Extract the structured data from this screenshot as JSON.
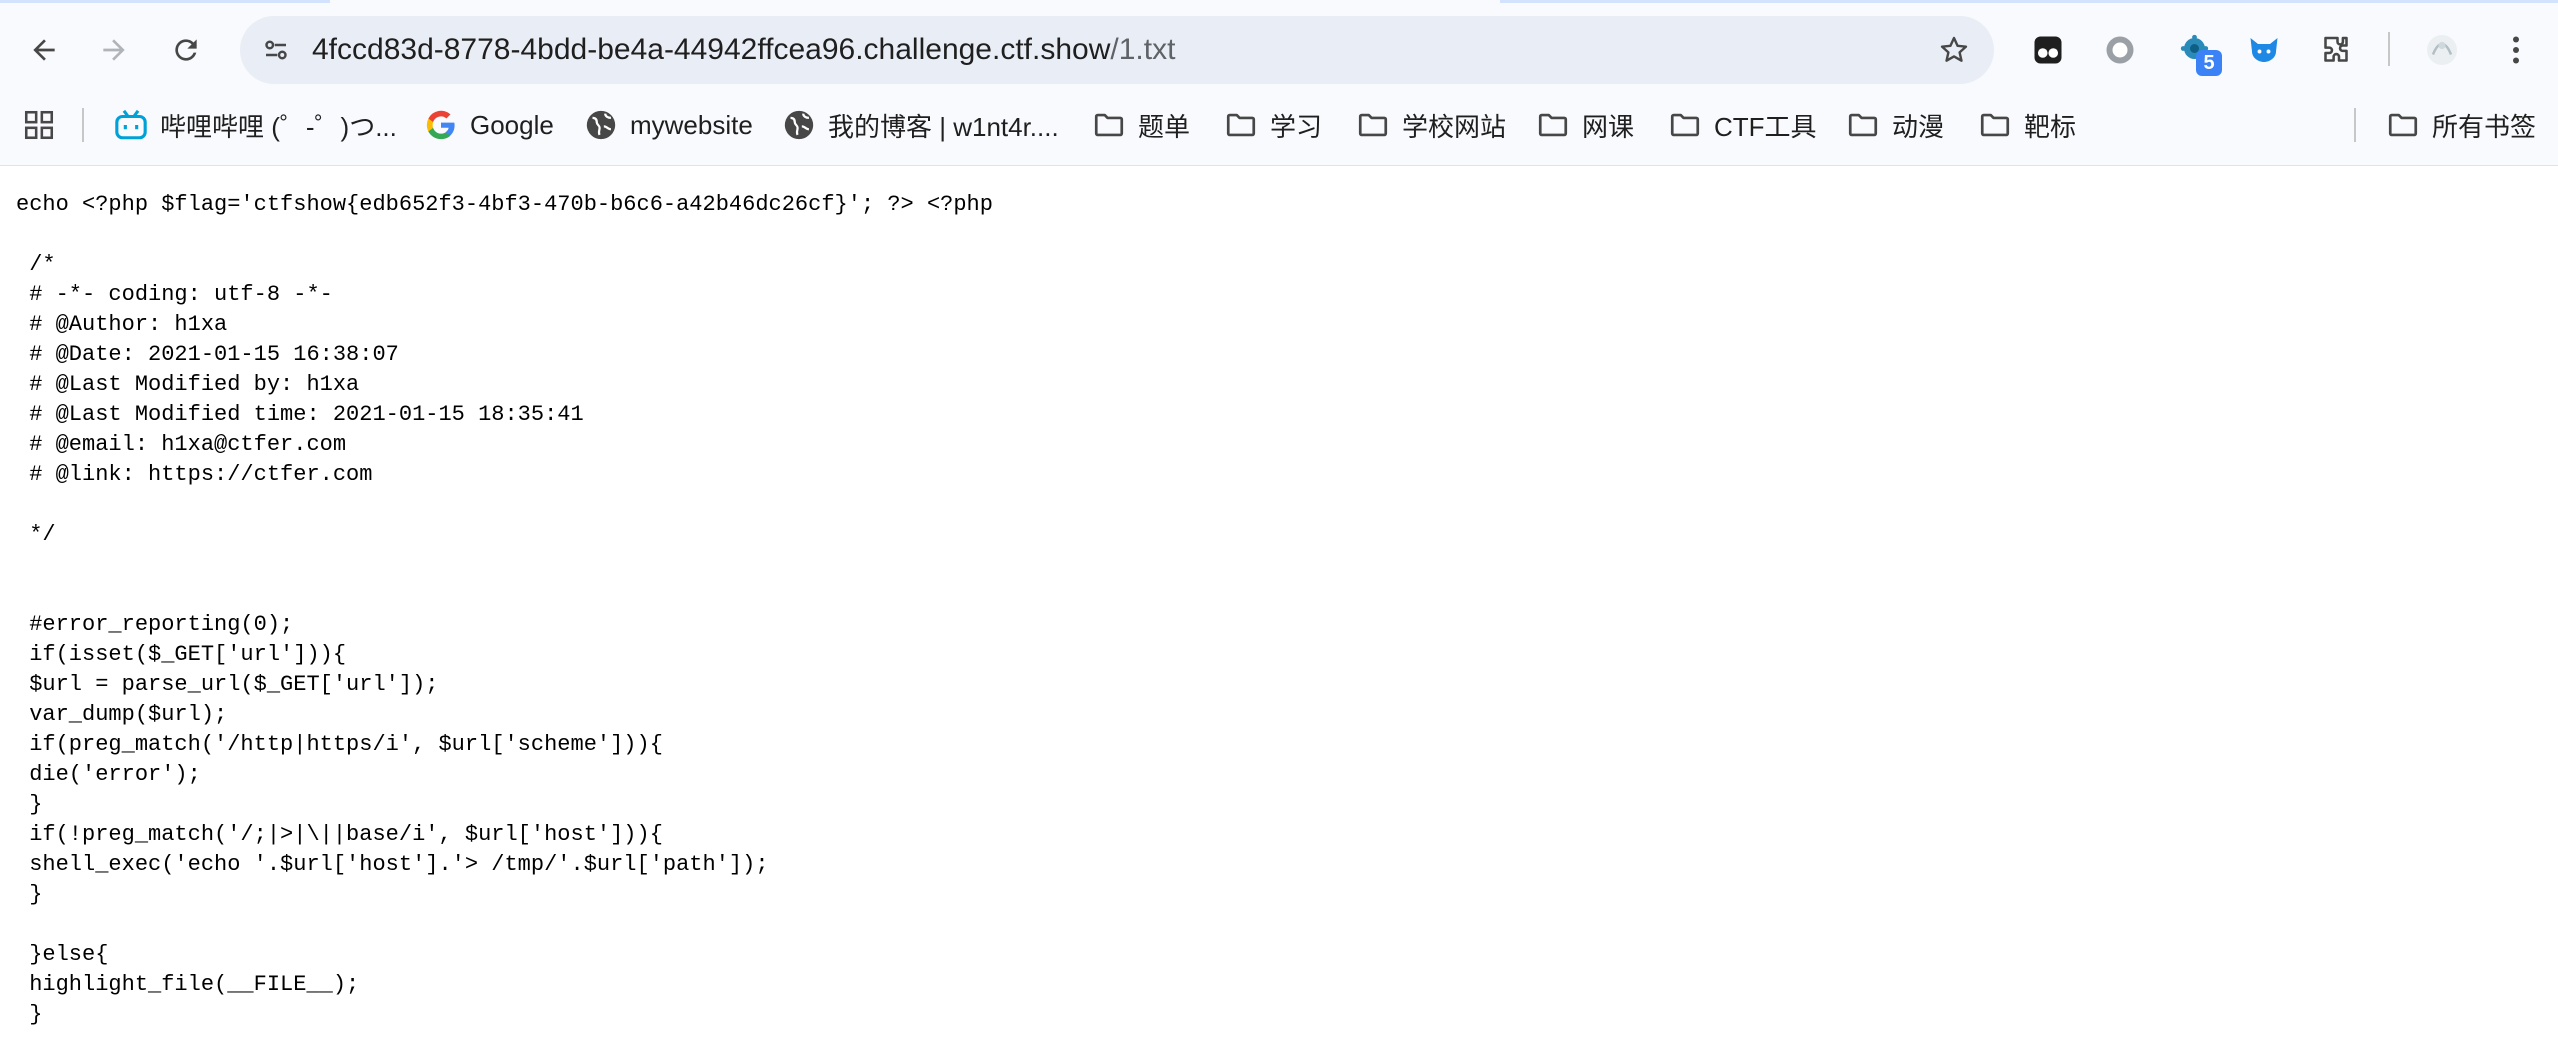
{
  "browser": {
    "url_host": "4fccd83d-8778-4bdd-be4a-44942ffcea96.challenge.ctf.show",
    "url_path": "/1.txt",
    "extensions": [
      {
        "name": "extension-tampermonkey-icon"
      },
      {
        "name": "extension-circle-icon"
      },
      {
        "name": "extension-gear-icon",
        "badge": "5"
      },
      {
        "name": "extension-fox-icon"
      },
      {
        "name": "extensions-puzzle-icon"
      },
      {
        "name": "profile-avatar-icon"
      },
      {
        "name": "menu-kebab-icon"
      }
    ]
  },
  "bookmarks": {
    "items": [
      {
        "label": "哔哩哔哩 (゜-゜)つ...",
        "icon": "bilibili-icon"
      },
      {
        "label": "Google",
        "icon": "google-icon"
      },
      {
        "label": "mywebsite",
        "icon": "globe-icon"
      },
      {
        "label": "我的博客 | w1nt4r....",
        "icon": "globe-icon"
      },
      {
        "label": "题单",
        "icon": "folder-icon"
      },
      {
        "label": "学习",
        "icon": "folder-icon"
      },
      {
        "label": "学校网站",
        "icon": "folder-icon"
      },
      {
        "label": "网课",
        "icon": "folder-icon"
      },
      {
        "label": "CTF工具",
        "icon": "folder-icon"
      },
      {
        "label": "动漫",
        "icon": "folder-icon"
      },
      {
        "label": "靶标",
        "icon": "folder-icon"
      },
      {
        "label": "所有书签",
        "icon": "folder-icon"
      }
    ]
  },
  "page": {
    "lines": [
      "echo <?php $flag='ctfshow{edb652f3-4bf3-470b-b6c6-a42b46dc26cf}'; ?> <?php",
      " /*",
      " # -*- coding: utf-8 -*-",
      " # @Author: h1xa",
      " # @Date: 2021-01-15 16:38:07",
      " # @Last Modified by: h1xa",
      " # @Last Modified time: 2021-01-15 18:35:41",
      " # @email: h1xa@ctfer.com",
      " # @link: https://ctfer.com",
      " */",
      " #error_reporting(0);",
      " if(isset($_GET['url'])){",
      " $url = parse_url($_GET['url']);",
      " var_dump($url);",
      " if(preg_match('/http|https/i', $url['scheme'])){",
      " die('error');",
      " }",
      " if(!preg_match('/;|>|\\||base/i', $url['host'])){",
      " shell_exec('echo '.$url['host'].'> /tmp/'.$url['path']);",
      " }",
      " }else{",
      " highlight_file(__FILE__);",
      " }"
    ]
  }
}
